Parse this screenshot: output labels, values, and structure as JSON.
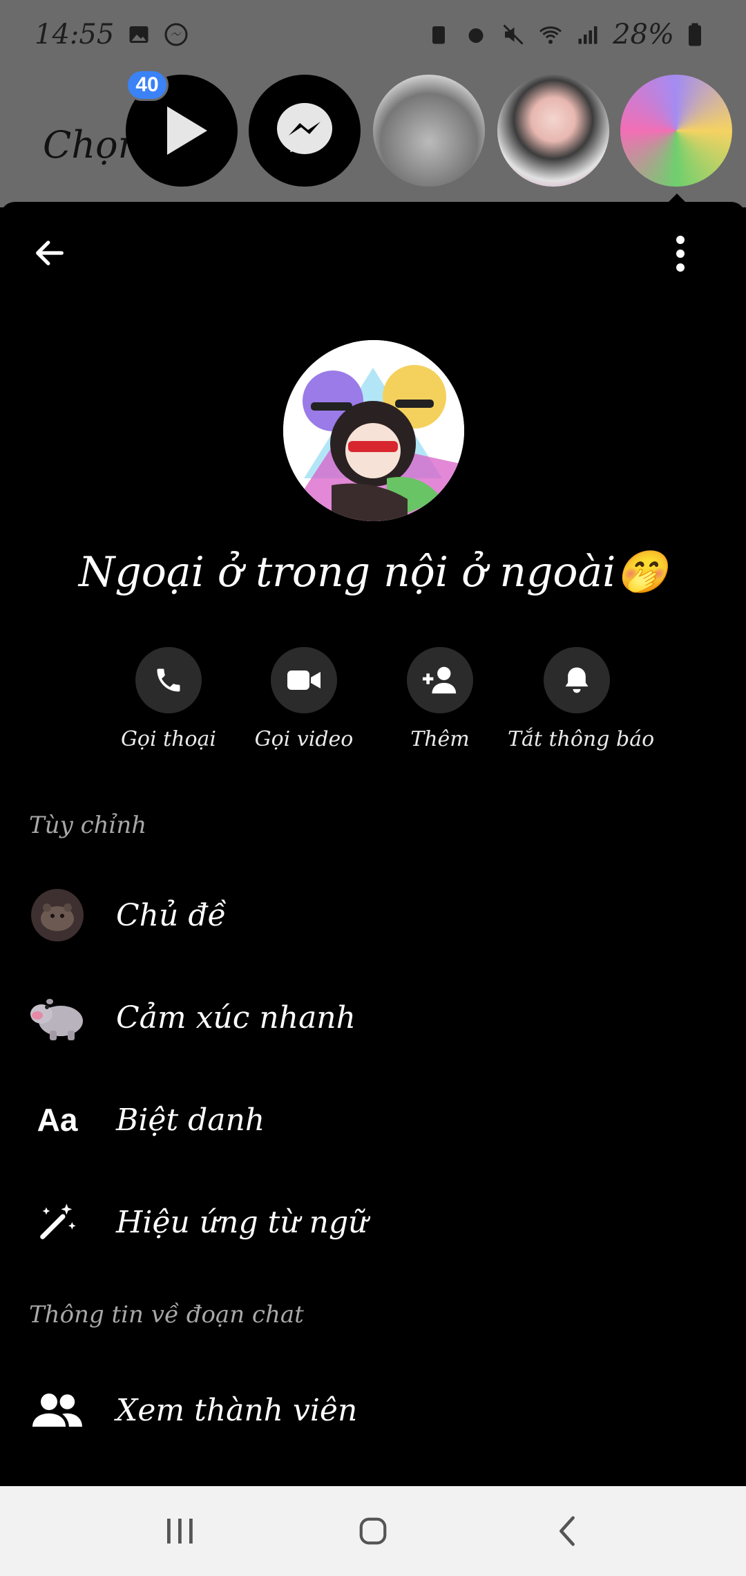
{
  "status_bar": {
    "time": "14:55",
    "battery": "28%"
  },
  "chat_heads": {
    "prefix_label": "Chọn",
    "unread_badge": "40"
  },
  "header": {
    "group_name": "Ngoại ở trong nội ở ngoài🤭"
  },
  "actions": [
    {
      "label": "Gọi thoại",
      "icon": "phone-icon"
    },
    {
      "label": "Gọi video",
      "icon": "video-camera-icon"
    },
    {
      "label": "Thêm",
      "icon": "add-person-icon"
    },
    {
      "label": "Tắt thông báo",
      "icon": "bell-icon"
    }
  ],
  "customize": {
    "header": "Tùy chỉnh",
    "items": [
      {
        "label": "Chủ đề",
        "icon": "theme-icon"
      },
      {
        "label": "Cảm xúc nhanh",
        "icon": "hippo-emoji-icon"
      },
      {
        "label": "Biệt danh",
        "icon": "aa-text-icon",
        "icon_text": "Aa"
      },
      {
        "label": "Hiệu ứng từ ngữ",
        "icon": "magic-wand-icon"
      }
    ]
  },
  "chat_info": {
    "header": "Thông tin về đoạn chat",
    "items": [
      {
        "label": "Xem thành viên",
        "icon": "people-icon"
      }
    ]
  },
  "colors": {
    "badge": "#3b82f6",
    "panel": "#000000",
    "dim_overlay": "#6b6b6b",
    "action_circle": "#2b2b2b"
  }
}
